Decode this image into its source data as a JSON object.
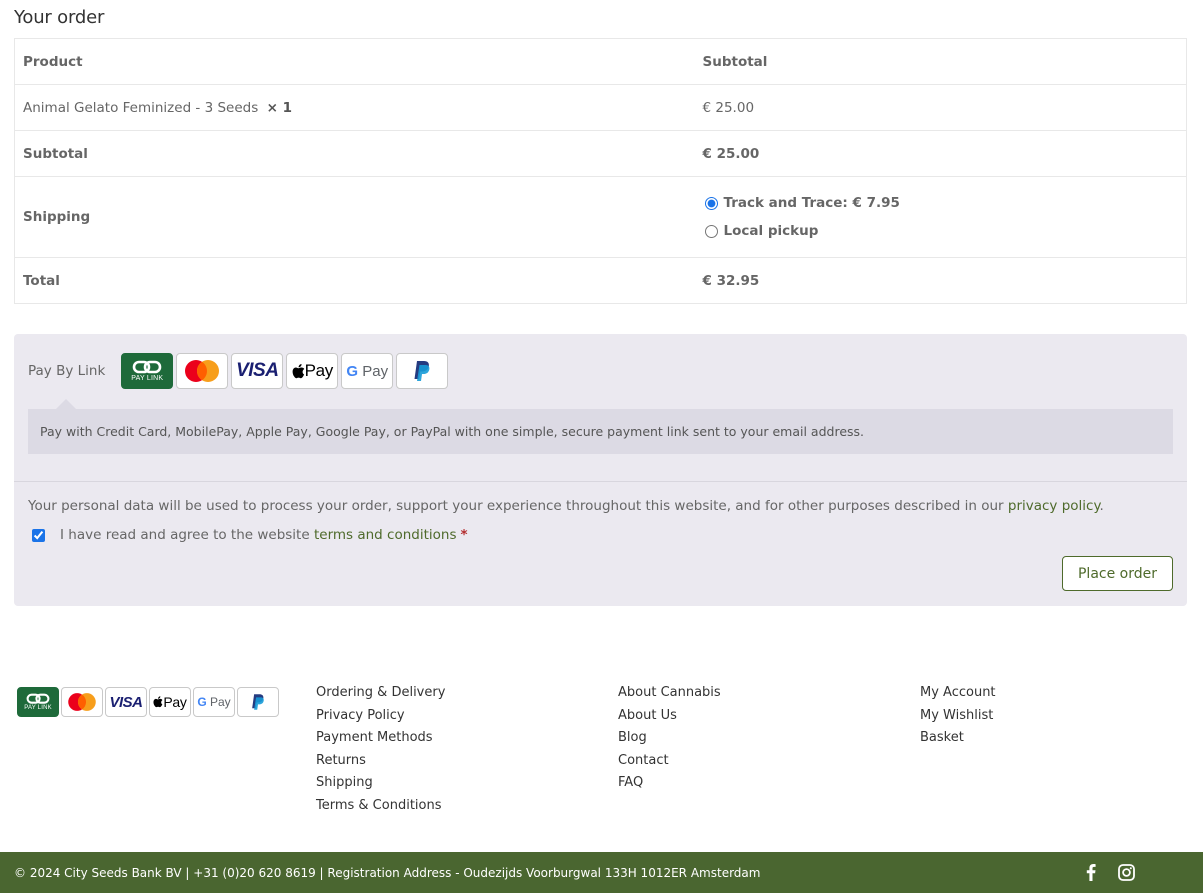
{
  "order": {
    "title": "Your order",
    "headers": {
      "product": "Product",
      "subtotal": "Subtotal"
    },
    "items": [
      {
        "name": "Animal Gelato Feminized - 3 Seeds",
        "qty": "× 1",
        "price": "€ 25.00"
      }
    ],
    "subtotal": {
      "label": "Subtotal",
      "value": "€ 25.00"
    },
    "shipping": {
      "label": "Shipping",
      "options": [
        {
          "label": "Track and Trace: € 7.95",
          "selected": true
        },
        {
          "label": "Local pickup",
          "selected": false
        }
      ]
    },
    "total": {
      "label": "Total",
      "value": "€ 32.95"
    }
  },
  "payment": {
    "method_label": "Pay By Link",
    "icons": [
      "pay-link-icon",
      "mastercard-icon",
      "visa-icon",
      "apple-pay-icon",
      "google-pay-icon",
      "paypal-icon"
    ],
    "paylink_text": "PAY LINK",
    "visa_text": "VISA",
    "applepay_text": "Pay",
    "gpay_text": "Pay",
    "description": "Pay with Credit Card, MobilePay, Apple Pay, Google Pay, or PayPal with one simple, secure payment link sent to your email address.",
    "privacy_prefix": "Your personal data will be used to process your order, support your experience throughout this website, and for other purposes described in our ",
    "privacy_link": "privacy policy",
    "privacy_suffix": ".",
    "terms_prefix": "I have read and agree to the website ",
    "terms_link": "terms and conditions",
    "terms_required": "*",
    "terms_checked": true,
    "place_order": "Place order"
  },
  "footer": {
    "col_a": [
      "Ordering & Delivery",
      "Privacy Policy",
      "Payment Methods",
      "Returns",
      "Shipping",
      "Terms & Conditions"
    ],
    "col_b": [
      "About Cannabis",
      "About Us",
      "Blog",
      "Contact",
      "FAQ"
    ],
    "col_c": [
      "My Account",
      "My Wishlist",
      "Basket"
    ],
    "copyright": "© 2024 City Seeds Bank BV | +31 (0)20 620 8619 | Registration Address - Oudezijds Voorburgwal 133H 1012ER Amsterdam",
    "social": [
      "facebook-icon",
      "instagram-icon"
    ]
  },
  "colors": {
    "accent_green": "#4e6a2b",
    "footer_bar": "#4a6630",
    "paylink_green": "#1e6a3a",
    "payment_bg": "#ebe9f0"
  }
}
